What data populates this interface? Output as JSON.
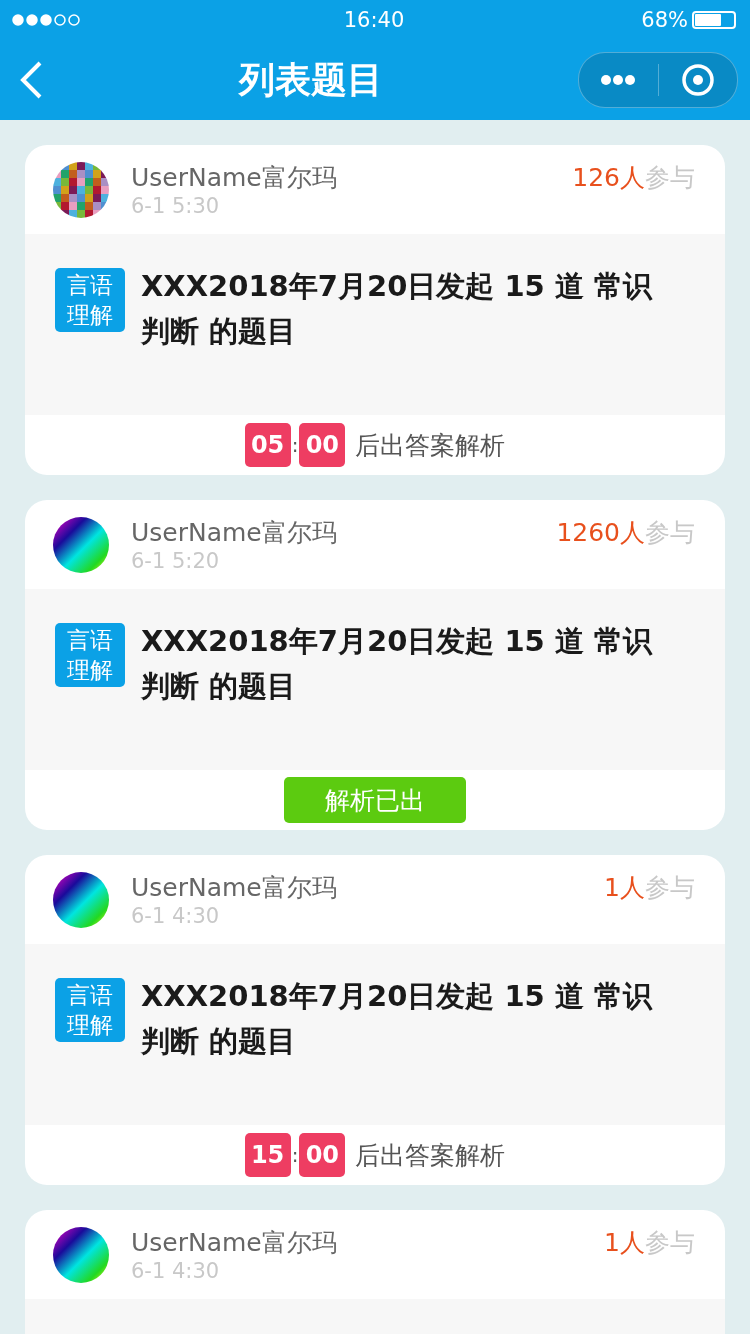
{
  "status_bar": {
    "time": "16:40",
    "battery_text": "68%",
    "battery": {
      "level": 0.68
    }
  },
  "nav": {
    "title": "列表题目"
  },
  "cards": [
    {
      "avatar": {
        "kind": "mosaic"
      },
      "user": "UserName富尔玛",
      "time": "6-1  5:30",
      "count": "126人",
      "count_suffix": "参与",
      "tag": "言语理解",
      "title": "XXX2018年7月20日发起 15 道 常识判断 的题目",
      "footer": {
        "kind": "countdown",
        "minutes": "05",
        "separator": ":",
        "seconds": "00",
        "text": "后出答案解析"
      }
    },
    {
      "avatar": {
        "kind": "gradient"
      },
      "user": "UserName富尔玛",
      "time": "6-1  5:20",
      "count": "1260人",
      "count_suffix": "参与",
      "tag": "言语理解",
      "title": "XXX2018年7月20日发起 15 道 常识判断 的题目",
      "footer": {
        "kind": "released",
        "text": "解析已出"
      }
    },
    {
      "avatar": {
        "kind": "gradient"
      },
      "user": "UserName富尔玛",
      "time": "6-1  4:30",
      "count": "1人",
      "count_suffix": "参与",
      "tag": "言语理解",
      "title": "XXX2018年7月20日发起 15 道 常识判断 的题目",
      "footer": {
        "kind": "countdown",
        "minutes": "15",
        "separator": ":",
        "seconds": "00",
        "text": "后出答案解析"
      }
    },
    {
      "avatar": {
        "kind": "gradient"
      },
      "user": "UserName富尔玛",
      "time": "6-1  4:30",
      "count": "1人",
      "count_suffix": "参与"
    }
  ]
}
